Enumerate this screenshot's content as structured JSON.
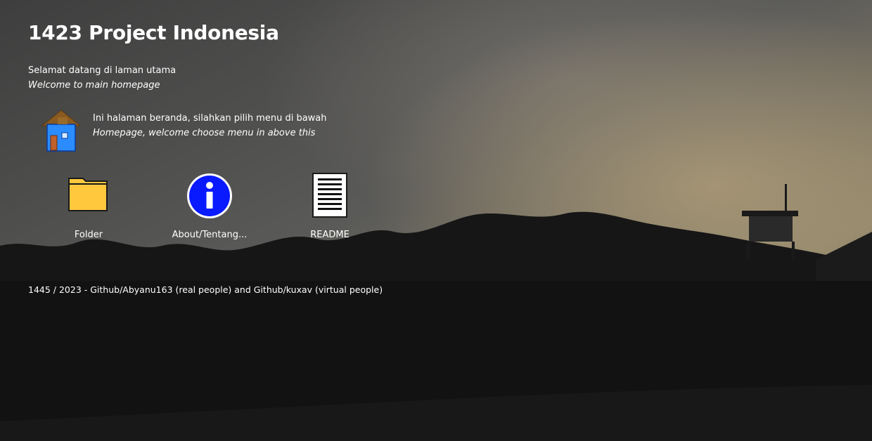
{
  "header": {
    "title": "1423 Project Indonesia"
  },
  "welcome": {
    "line_id": "Selamat datang di laman utama",
    "line_en": "Welcome to main homepage"
  },
  "intro": {
    "icon": "home-icon",
    "line_id": "Ini halaman beranda, silahkan pilih menu di bawah",
    "line_en": "Homepage, welcome choose menu in above this"
  },
  "menu": {
    "items": [
      {
        "label": "Folder",
        "icon": "folder-icon",
        "color": "#FFC83D"
      },
      {
        "label": "About/Tentang...",
        "icon": "info-icon",
        "color": "#0A1AFF"
      },
      {
        "label": "README",
        "icon": "document-icon",
        "color": "#FFFFFF"
      }
    ]
  },
  "footer": {
    "text": "1445 / 2023 - Github/Abyanu163 (real people) and Github/kuxav (virtual people)"
  },
  "colors": {
    "text": "#FFFFFF",
    "sky_top": "#4a4a4a",
    "sky_glow": "#9b8d6c",
    "ground": "#141414"
  }
}
